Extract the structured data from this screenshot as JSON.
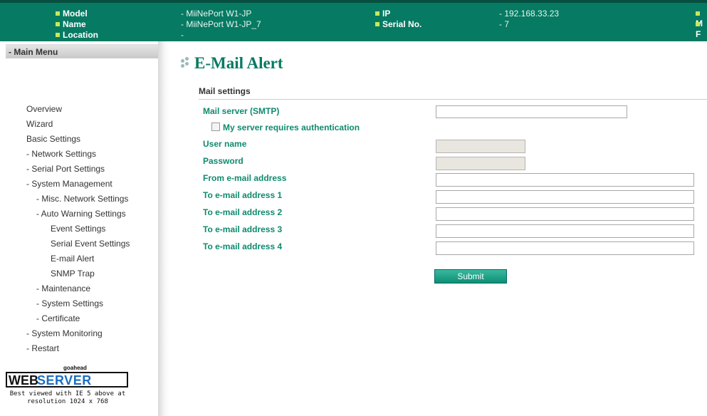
{
  "header": {
    "rows": [
      {
        "label1": "Model",
        "value1": "- MiiNePort W1-JP",
        "label2": "IP",
        "value2": "- 192.168.33.23",
        "label3": "M"
      },
      {
        "label1": "Name",
        "value1": "- MiiNePort W1-JP_7",
        "label2": "Serial No.",
        "value2": "- 7",
        "label3": "F"
      },
      {
        "label1": "Location",
        "value1": "-",
        "label2": "",
        "value2": "",
        "label3": ""
      }
    ]
  },
  "sidebar": {
    "menu_title": "- Main Menu",
    "items": [
      "Overview",
      "Wizard",
      "Basic Settings",
      "- Network Settings",
      "- Serial Port Settings",
      "- System Management",
      "- Misc. Network Settings",
      "- Auto Warning Settings",
      "Event Settings",
      "Serial Event Settings",
      "E-mail Alert",
      "SNMP Trap",
      "- Maintenance",
      "- System Settings",
      "- Certificate",
      "- System Monitoring",
      "- Restart"
    ],
    "logo": {
      "goahead": "goahead",
      "web": "WEB",
      "server": "SERVER",
      "note_line1": "Best viewed with IE 5 above at",
      "note_line2": "resolution 1024 x 768"
    }
  },
  "main": {
    "title": "E-Mail Alert",
    "section": "Mail settings",
    "fields": {
      "smtp": {
        "label": "Mail server (SMTP)",
        "value": ""
      },
      "auth": {
        "label": "My server requires authentication",
        "checked": false
      },
      "user": {
        "label": "User name",
        "value": ""
      },
      "password": {
        "label": "Password",
        "value": ""
      },
      "from": {
        "label": "From e-mail address",
        "value": ""
      },
      "to1": {
        "label": "To e-mail address 1",
        "value": ""
      },
      "to2": {
        "label": "To e-mail address 2",
        "value": ""
      },
      "to3": {
        "label": "To e-mail address 3",
        "value": ""
      },
      "to4": {
        "label": "To e-mail address 4",
        "value": ""
      }
    },
    "submit_label": "Submit"
  },
  "colors": {
    "header_bg": "#067a62",
    "accent": "#0f8a6e"
  }
}
